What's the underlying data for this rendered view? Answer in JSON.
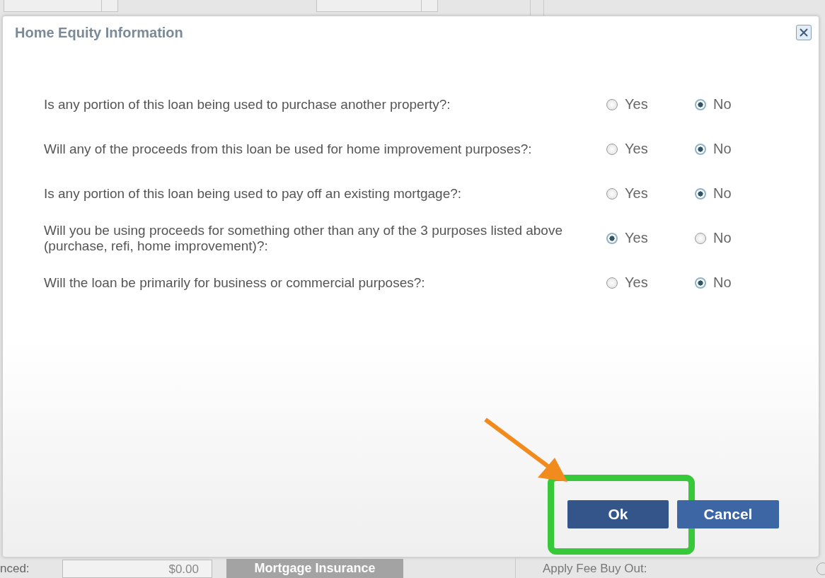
{
  "background": {
    "financed_label": "nced:",
    "financed_value": "$0.00",
    "disabled_button": "Mortgage Insurance",
    "fee_label": "Apply Fee Buy Out:",
    "fee_radio_selected": false
  },
  "dialog": {
    "title": "Home Equity Information",
    "questions": [
      {
        "text": "Is any portion of this loan being used to purchase another property?:",
        "options": [
          {
            "label": "Yes",
            "selected": false
          },
          {
            "label": "No",
            "selected": true
          }
        ]
      },
      {
        "text": "Will any of the proceeds from this loan be used for home improvement purposes?:",
        "options": [
          {
            "label": "Yes",
            "selected": false
          },
          {
            "label": "No",
            "selected": true
          }
        ]
      },
      {
        "text": "Is any portion of this loan being used to pay off an existing mortgage?:",
        "options": [
          {
            "label": "Yes",
            "selected": false
          },
          {
            "label": "No",
            "selected": true
          }
        ]
      },
      {
        "text": "Will you be using proceeds for something other than any of the 3 purposes listed above (purchase, refi, home improvement)?:",
        "options": [
          {
            "label": "Yes",
            "selected": true
          },
          {
            "label": "No",
            "selected": false
          }
        ]
      },
      {
        "text": "Will the loan be primarily for business or commercial purposes?:",
        "options": [
          {
            "label": "Yes",
            "selected": false
          },
          {
            "label": "No",
            "selected": true
          }
        ]
      }
    ],
    "buttons": [
      {
        "label": "Ok",
        "highlighted": true
      },
      {
        "label": "Cancel",
        "highlighted": false
      }
    ]
  },
  "annotation": {
    "arrow": true
  }
}
